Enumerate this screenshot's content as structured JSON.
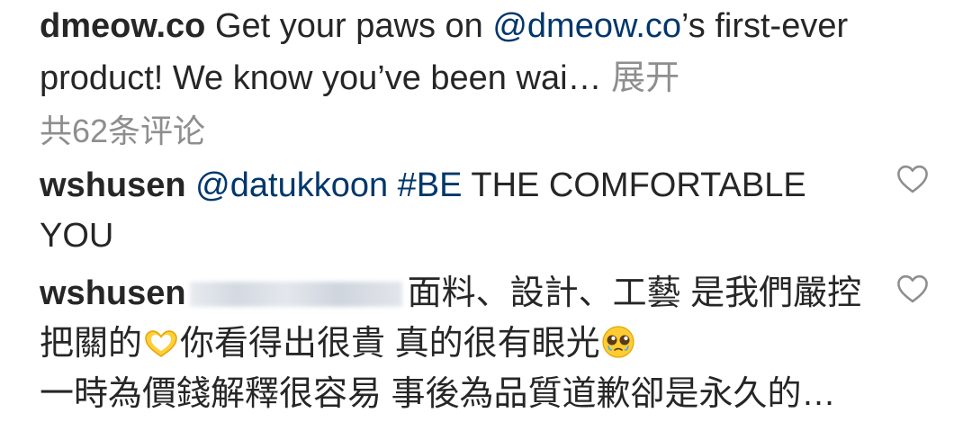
{
  "post": {
    "username": "dmeow.co",
    "caption_pre": " Get your paws on ",
    "caption_mention": "@dmeow.co",
    "caption_post": "’s first-ever product! We know you’ve been wai…",
    "expand_label": " 展开"
  },
  "comments_summary": {
    "view_all_label": "共62条评论"
  },
  "comments": [
    {
      "username": "wshusen",
      "mention": "@datukkoon",
      "hashtag": "#BE",
      "text": " THE COMFORTABLE YOU",
      "like_icon": "heart-outline-icon"
    },
    {
      "username": "wshusen",
      "text_a": "面料、設計、工藝 是我們嚴控把關的",
      "emoji_1": "heart-hands-emoji",
      "text_b": "你看得出很貴 真的很有眼光",
      "emoji_2": "pleading-face-emoji",
      "text_c": "一時為價錢解釋很容易 事後為品質道歉卻是永久的…",
      "like_icon": "heart-outline-icon"
    }
  ],
  "colors": {
    "text": "#262626",
    "link": "#00376b",
    "muted": "#8e8e8e"
  }
}
